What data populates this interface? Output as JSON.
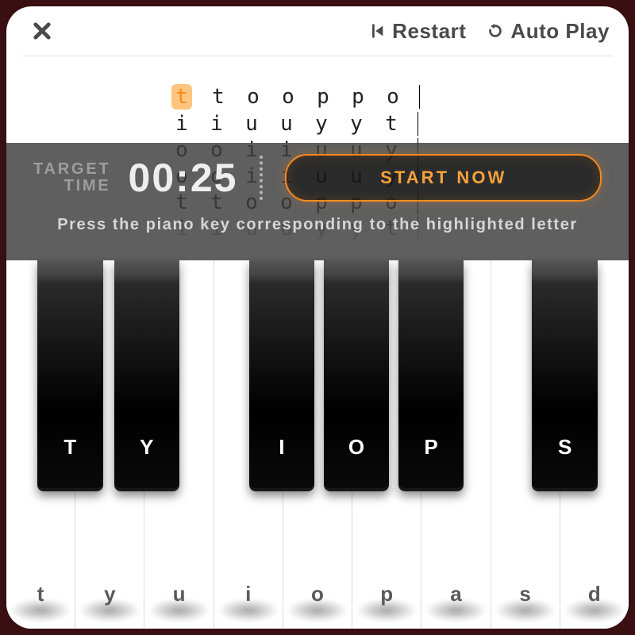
{
  "toolbar": {
    "restart_label": "Restart",
    "autoplay_label": "Auto Play"
  },
  "sequence": {
    "highlight_char": "t",
    "rows": [
      [
        "t",
        "t",
        "o",
        "o",
        "p",
        "p",
        "o"
      ],
      [
        "i",
        "i",
        "u",
        "u",
        "y",
        "y",
        "t"
      ],
      [
        "o",
        "o",
        "i",
        "i",
        "u",
        "u",
        "y"
      ],
      [
        "o",
        "o",
        "i",
        "i",
        "u",
        "u",
        "y"
      ],
      [
        "t",
        "t",
        "o",
        "o",
        "p",
        "p",
        "o"
      ],
      [
        "i",
        "i",
        "u",
        "u",
        "y",
        "y",
        "t"
      ]
    ]
  },
  "overlay": {
    "target_label_line1": "TARGET",
    "target_label_line2": "TIME",
    "target_time": "00:25",
    "start_label": "START NOW",
    "hint": "Press the piano key corresponding to the highlighted letter"
  },
  "piano": {
    "white_keys": [
      "t",
      "y",
      "u",
      "i",
      "o",
      "p",
      "a",
      "s",
      "d"
    ],
    "black_keys": [
      {
        "label": "T",
        "left_pct": 5.0,
        "width_pct": 10.5
      },
      {
        "label": "Y",
        "left_pct": 17.3,
        "width_pct": 10.5
      },
      {
        "label": "I",
        "left_pct": 39.0,
        "width_pct": 10.5
      },
      {
        "label": "O",
        "left_pct": 51.0,
        "width_pct": 10.5
      },
      {
        "label": "P",
        "left_pct": 63.0,
        "width_pct": 10.5
      },
      {
        "label": "S",
        "left_pct": 84.5,
        "width_pct": 10.5
      }
    ]
  }
}
